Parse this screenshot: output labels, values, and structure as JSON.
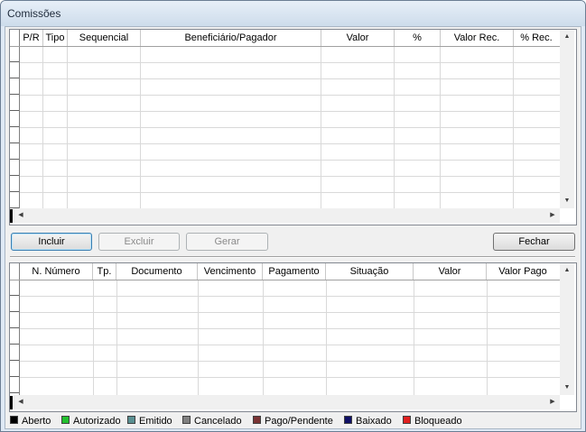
{
  "window": {
    "title": "Comissões"
  },
  "top_grid": {
    "columns": [
      "P/R",
      "Tipo",
      "Sequencial",
      "Beneficiário/Pagador",
      "Valor",
      "%",
      "Valor Rec.",
      "% Rec."
    ]
  },
  "buttons": {
    "incluir": "Incluir",
    "excluir": "Excluir",
    "gerar": "Gerar",
    "fechar": "Fechar"
  },
  "bottom_grid": {
    "columns": [
      "N. Número",
      "Tp.",
      "Documento",
      "Vencimento",
      "Pagamento",
      "Situação",
      "Valor",
      "Valor Pago"
    ]
  },
  "legend": [
    {
      "label": "Aberto",
      "color": "#000000"
    },
    {
      "label": "Autorizado",
      "color": "#22c02e"
    },
    {
      "label": "Emitido",
      "color": "#5a9092"
    },
    {
      "label": "Cancelado",
      "color": "#808080"
    },
    {
      "label": "Pago/Pendente",
      "color": "#7a3434"
    },
    {
      "label": "Baixado",
      "color": "#101066"
    },
    {
      "label": "Bloqueado",
      "color": "#e02020"
    }
  ]
}
